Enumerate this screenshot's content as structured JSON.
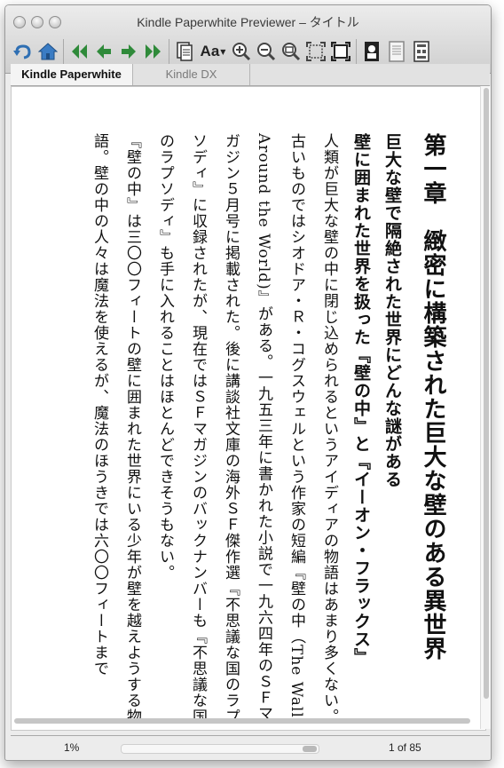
{
  "window": {
    "title": "Kindle Paperwhite Previewer – タイトル"
  },
  "toolbar": {
    "buttons": [
      {
        "icon": "undo-icon"
      },
      {
        "icon": "home-icon"
      },
      {
        "icon": "first-page-icon"
      },
      {
        "icon": "previous-page-icon"
      },
      {
        "icon": "next-page-icon"
      },
      {
        "icon": "last-page-icon"
      },
      {
        "icon": "table-of-contents-icon"
      },
      {
        "icon": "font-size-icon",
        "label": "Aa"
      },
      {
        "icon": "zoom-in-icon"
      },
      {
        "icon": "zoom-out-icon"
      },
      {
        "icon": "zoom-reset-icon"
      },
      {
        "icon": "fit-page-icon"
      },
      {
        "icon": "full-screen-icon"
      },
      {
        "icon": "portrait-orientation-icon"
      },
      {
        "icon": "document-icon"
      },
      {
        "icon": "device-settings-icon"
      }
    ]
  },
  "tabs": {
    "active": "Kindle Paperwhite",
    "inactive": "Kindle DX"
  },
  "content": {
    "chapter_title": "第一章　緻密に構築された巨大な壁のある異世界",
    "subtitle_line1": "巨大な壁で隔絶された世界にどんな謎がある",
    "subtitle_line2": "壁に囲まれた世界を扱った『壁の中』と『イーオン・フラックス』",
    "paragraph1": "人類が巨大な壁の中に閉じ込められるというアイディアの物語はあまり多くない。古いものではシオドア・Ｒ・コグスウェルという作家の短編『壁の中（The Wall Around the World)』がある。一九五三年に書かれた小説で一九六四年のＳＦマガジン５月号に掲載された。後に講談社文庫の海外ＳＦ傑作選『不思議な国のラプソディ』に収録されたが、現在ではＳＦマガジンのバックナンバーも『不思議な国のラプソディ』も手に入れることはほとんどできそうもない。",
    "paragraph2": "『壁の中』は三〇〇フィートの壁に囲まれた世界にいる少年が壁を越えようする物語。壁の中の人々は魔法を使えるが、魔法のほうきでは六〇〇フィートまで"
  },
  "status": {
    "progress_percent": "1%",
    "progress_fraction": 0.01,
    "page": "1 of 85"
  },
  "colors": {
    "window_bg": "#ececec",
    "toolbar_icon_blue": "#2f6fb3",
    "toolbar_icon_green": "#2f8a3a",
    "text": "#111111"
  }
}
